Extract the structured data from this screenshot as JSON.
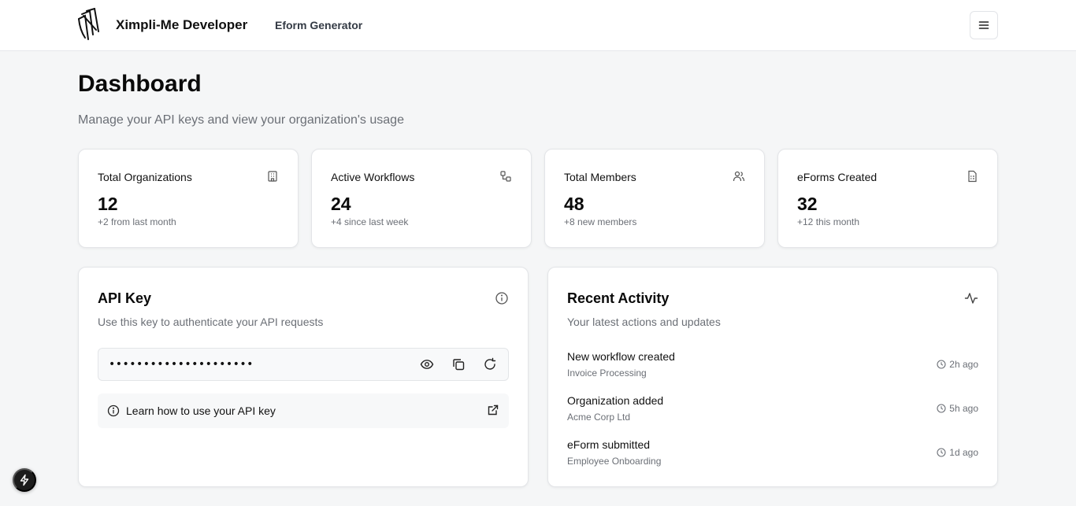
{
  "header": {
    "brand": "Ximpli-Me Developer",
    "nav_link": "Eform Generator"
  },
  "page": {
    "title": "Dashboard",
    "subtitle": "Manage your API keys and view your organization's usage"
  },
  "stats": [
    {
      "label": "Total Organizations",
      "value": "12",
      "change": "+2 from last month",
      "icon": "building-icon"
    },
    {
      "label": "Active Workflows",
      "value": "24",
      "change": "+4 since last week",
      "icon": "workflow-icon"
    },
    {
      "label": "Total Members",
      "value": "48",
      "change": "+8 new members",
      "icon": "users-icon"
    },
    {
      "label": "eForms Created",
      "value": "32",
      "change": "+12 this month",
      "icon": "file-sheet-icon"
    }
  ],
  "api_key": {
    "title": "API Key",
    "subtitle": "Use this key to authenticate your API requests",
    "masked_key": "•••••••••••••••••••••",
    "learn_text": "Learn how to use your API key"
  },
  "activity": {
    "title": "Recent Activity",
    "subtitle": "Your latest actions and updates",
    "items": [
      {
        "title": "New workflow created",
        "detail": "Invoice Processing",
        "time": "2h ago"
      },
      {
        "title": "Organization added",
        "detail": "Acme Corp Ltd",
        "time": "5h ago"
      },
      {
        "title": "eForm submitted",
        "detail": "Employee Onboarding",
        "time": "1d ago"
      }
    ]
  },
  "colors": {
    "background": "#f5f6f7",
    "card": "#ffffff",
    "muted_text": "#6b6f76",
    "fab": "#1c1c1c"
  }
}
